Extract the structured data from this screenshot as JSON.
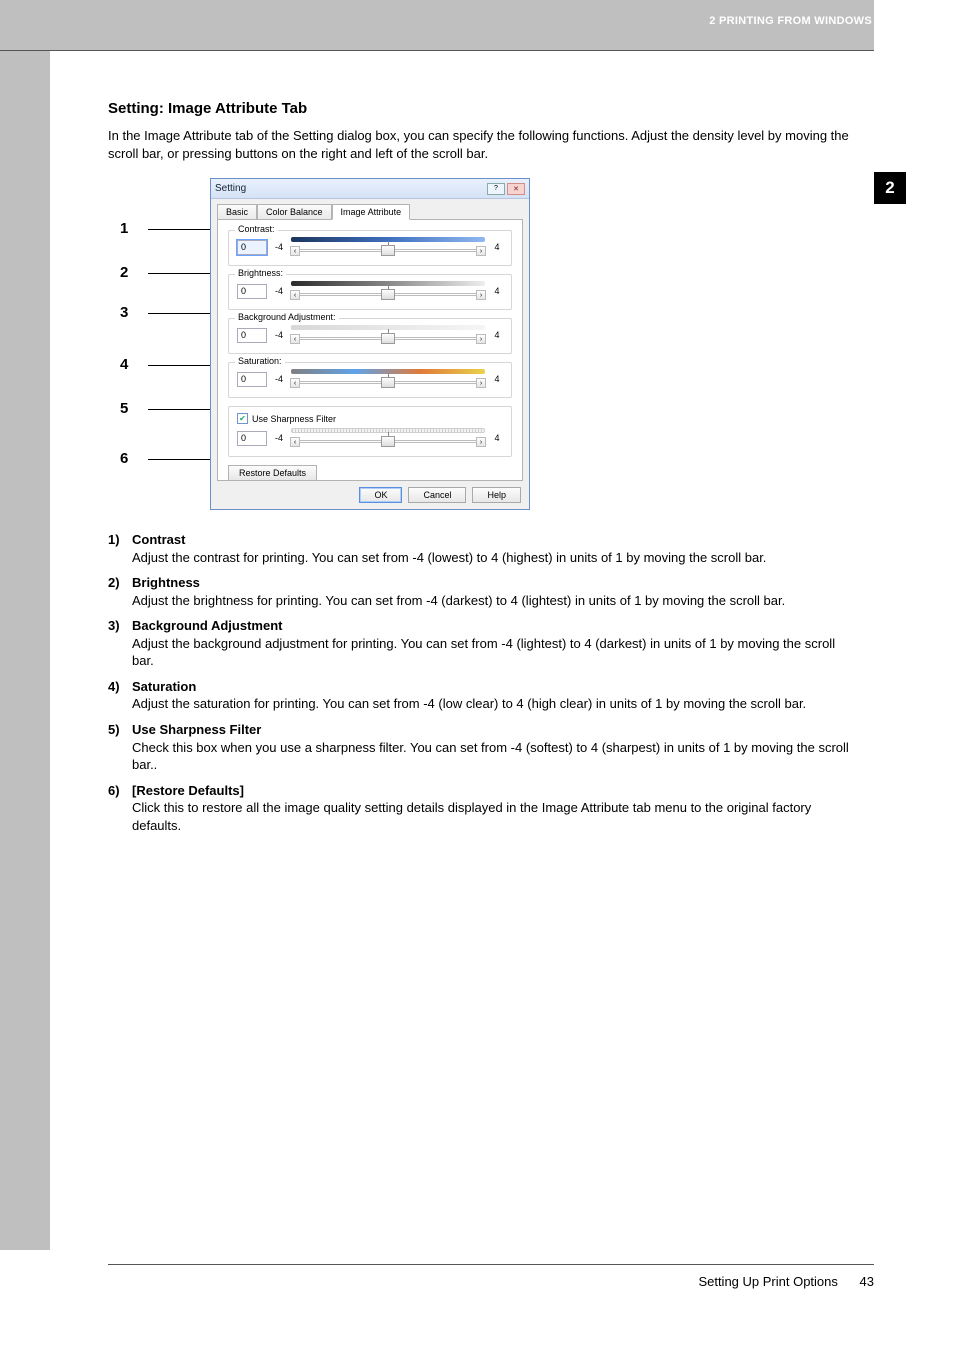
{
  "header": {
    "breadcrumb": "2 PRINTING FROM WINDOWS"
  },
  "chapter_tab": "2",
  "section_title": "Setting: Image Attribute Tab",
  "intro": "In the Image Attribute tab of the Setting dialog box, you can specify the following functions. Adjust the density level by moving the scroll bar, or pressing buttons on the right and left of the scroll bar.",
  "dialog": {
    "title": "Setting",
    "win_buttons": {
      "help": "?",
      "close": "✕"
    },
    "tabs": {
      "basic": "Basic",
      "color_balance": "Color Balance",
      "image_attribute": "Image Attribute"
    },
    "contrast": {
      "label": "Contrast:",
      "value": "0",
      "min": "-4",
      "max": "4"
    },
    "brightness": {
      "label": "Brightness:",
      "value": "0",
      "min": "-4",
      "max": "4"
    },
    "background": {
      "label": "Background Adjustment:",
      "value": "0",
      "min": "-4",
      "max": "4"
    },
    "saturation": {
      "label": "Saturation:",
      "value": "0",
      "min": "-4",
      "max": "4"
    },
    "sharpness": {
      "checkbox_label": "Use Sharpness Filter",
      "checked": true,
      "value": "0",
      "min": "-4",
      "max": "4"
    },
    "restore_defaults": "Restore Defaults",
    "ok": "OK",
    "cancel": "Cancel",
    "help": "Help"
  },
  "callouts": [
    "1",
    "2",
    "3",
    "4",
    "5",
    "6"
  ],
  "desc": [
    {
      "n": "1)",
      "title": "Contrast",
      "body": "Adjust the contrast for printing. You can set from -4 (lowest) to 4 (highest) in units of 1 by moving the scroll bar."
    },
    {
      "n": "2)",
      "title": "Brightness",
      "body": "Adjust the brightness for printing. You can set from -4 (darkest) to 4 (lightest) in units of 1 by moving the scroll bar."
    },
    {
      "n": "3)",
      "title": "Background Adjustment",
      "body": "Adjust the background adjustment for printing. You can set from -4 (lightest) to 4 (darkest) in units of 1 by moving the scroll bar."
    },
    {
      "n": "4)",
      "title": "Saturation",
      "body": "Adjust the saturation for printing.  You can set from -4 (low clear) to 4 (high clear) in units of 1 by moving the scroll bar."
    },
    {
      "n": "5)",
      "title": "Use Sharpness Filter",
      "body": "Check this box when you use a sharpness filter. You can set from -4 (softest) to 4 (sharpest) in units of 1 by moving the scroll bar.."
    },
    {
      "n": "6)",
      "title": "[Restore Defaults]",
      "body": "Click this to restore all the image quality setting details displayed in the Image Attribute tab menu to the original factory defaults."
    }
  ],
  "footer": {
    "section": "Setting Up Print Options",
    "page": "43"
  }
}
